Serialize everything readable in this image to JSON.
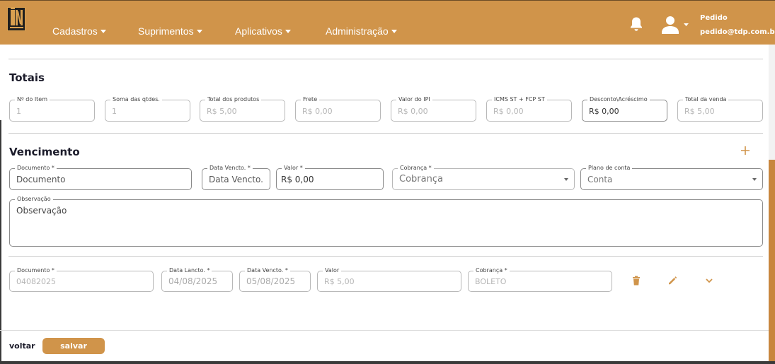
{
  "navbar": {
    "menu": [
      "Cadastros",
      "Suprimentos",
      "Aplicativos",
      "Administração"
    ],
    "user_name": "Pedido",
    "user_email": "pedido@tdp.com.br"
  },
  "colors": {
    "primary": "#d0944a",
    "text": "#1b1b2a",
    "border": "#b8b8b8"
  },
  "totais": {
    "title": "Totais",
    "fields": [
      {
        "label": "Nº do Item",
        "value": "1"
      },
      {
        "label": "Soma das qtdes.",
        "value": "1"
      },
      {
        "label": "Total dos produtos",
        "value": "R$ 5,00"
      },
      {
        "label": "Frete",
        "value": "R$ 0,00"
      },
      {
        "label": "Valor do IPI",
        "value": "R$ 0,00"
      },
      {
        "label": "ICMS ST + FCP ST",
        "value": "R$ 0,00"
      },
      {
        "label": "Desconto\\Acréscimo",
        "value": "R$ 0,00"
      },
      {
        "label": "Total da venda",
        "value": "R$ 5,00"
      }
    ]
  },
  "vencimento": {
    "title": "Vencimento",
    "add_icon": "plus-icon",
    "form": {
      "documento": {
        "label": "Documento *",
        "placeholder": "Documento"
      },
      "data_vencto": {
        "label": "Data Vencto. *",
        "placeholder": "Data Vencto."
      },
      "valor": {
        "label": "Valor *",
        "value": "R$ 0,00"
      },
      "cobranca": {
        "label": "Cobrança *",
        "placeholder": "Cobrança"
      },
      "plano": {
        "label": "Plano de conta",
        "placeholder": "Conta"
      },
      "observacao": {
        "label": "Observação",
        "placeholder": "Observação"
      }
    },
    "rows": [
      {
        "documento": {
          "label": "Documento *",
          "value": "04082025"
        },
        "data_lancto": {
          "label": "Data Lancto. *",
          "value": "04/08/2025"
        },
        "data_vencto": {
          "label": "Data Vencto. *",
          "value": "05/08/2025"
        },
        "valor": {
          "label": "Valor",
          "value": "R$ 5,00"
        },
        "cobranca": {
          "label": "Cobrança *",
          "value": "BOLETO"
        },
        "icons": [
          "trash-icon",
          "pencil-icon",
          "chevron-down-icon"
        ]
      }
    ]
  },
  "footer": {
    "back": "voltar",
    "save": "salvar"
  }
}
